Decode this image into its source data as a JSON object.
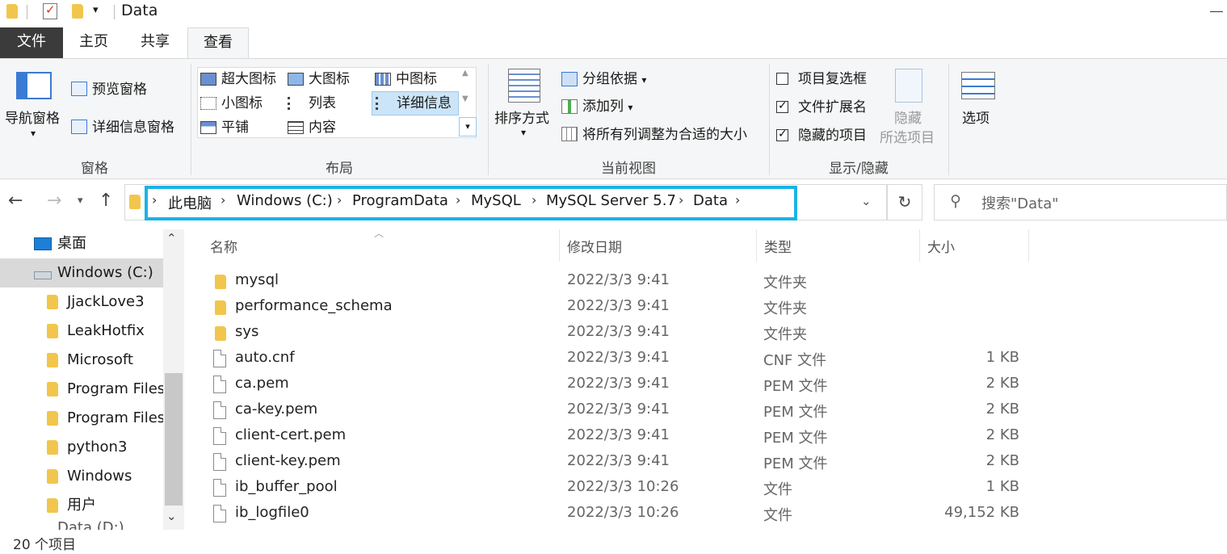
{
  "window": {
    "title": "Data"
  },
  "ribbon_tabs": {
    "file": "文件",
    "home": "主页",
    "share": "共享",
    "view": "查看"
  },
  "ribbon": {
    "panes": {
      "nav_pane": "导航窗格",
      "preview_pane": "预览窗格",
      "details_pane": "详细信息窗格",
      "label": "窗格"
    },
    "layout": {
      "extra_large": "超大图标",
      "large": "大图标",
      "medium": "中图标",
      "small": "小图标",
      "list": "列表",
      "details": "详细信息",
      "tiles": "平铺",
      "content": "内容",
      "label": "布局"
    },
    "current_view": {
      "sort_by": "排序方式",
      "group_by": "分组依据",
      "add_column": "添加列",
      "size_all": "将所有列调整为合适的大小",
      "label": "当前视图"
    },
    "show_hide": {
      "item_checkboxes": "项目复选框",
      "file_extensions": "文件扩展名",
      "hidden_items": "隐藏的项目",
      "hide_selected_1": "隐藏",
      "hide_selected_2": "所选项目",
      "options": "选项",
      "label": "显示/隐藏"
    }
  },
  "address": {
    "crumbs": [
      "此电脑",
      "Windows (C:)",
      "ProgramData",
      "MySQL",
      "MySQL Server 5.7",
      "Data"
    ],
    "search_placeholder": "搜索\"Data\""
  },
  "nav": {
    "items": [
      "桌面",
      "Windows (C:)",
      "JjackLove3",
      "LeakHotfix",
      "Microsoft",
      "Program Files",
      "Program Files",
      "python3",
      "Windows",
      "用户"
    ],
    "partial": "Data (D:)"
  },
  "columns": {
    "name": "名称",
    "date": "修改日期",
    "type": "类型",
    "size": "大小"
  },
  "files": [
    {
      "name": "mysql",
      "date": "2022/3/3 9:41",
      "type": "文件夹",
      "size": ""
    },
    {
      "name": "performance_schema",
      "date": "2022/3/3 9:41",
      "type": "文件夹",
      "size": ""
    },
    {
      "name": "sys",
      "date": "2022/3/3 9:41",
      "type": "文件夹",
      "size": ""
    },
    {
      "name": "auto.cnf",
      "date": "2022/3/3 9:41",
      "type": "CNF 文件",
      "size": "1 KB"
    },
    {
      "name": "ca.pem",
      "date": "2022/3/3 9:41",
      "type": "PEM 文件",
      "size": "2 KB"
    },
    {
      "name": "ca-key.pem",
      "date": "2022/3/3 9:41",
      "type": "PEM 文件",
      "size": "2 KB"
    },
    {
      "name": "client-cert.pem",
      "date": "2022/3/3 9:41",
      "type": "PEM 文件",
      "size": "2 KB"
    },
    {
      "name": "client-key.pem",
      "date": "2022/3/3 9:41",
      "type": "PEM 文件",
      "size": "2 KB"
    },
    {
      "name": "ib_buffer_pool",
      "date": "2022/3/3 10:26",
      "type": "文件",
      "size": "1 KB"
    },
    {
      "name": "ib_logfile0",
      "date": "2022/3/3 10:26",
      "type": "文件",
      "size": "49,152 KB"
    }
  ],
  "status": {
    "count": "20 个项目"
  },
  "colors": {
    "accent": "#1ab2e8",
    "file_tab": "#3b3b3b",
    "folder": "#f2c64d"
  }
}
